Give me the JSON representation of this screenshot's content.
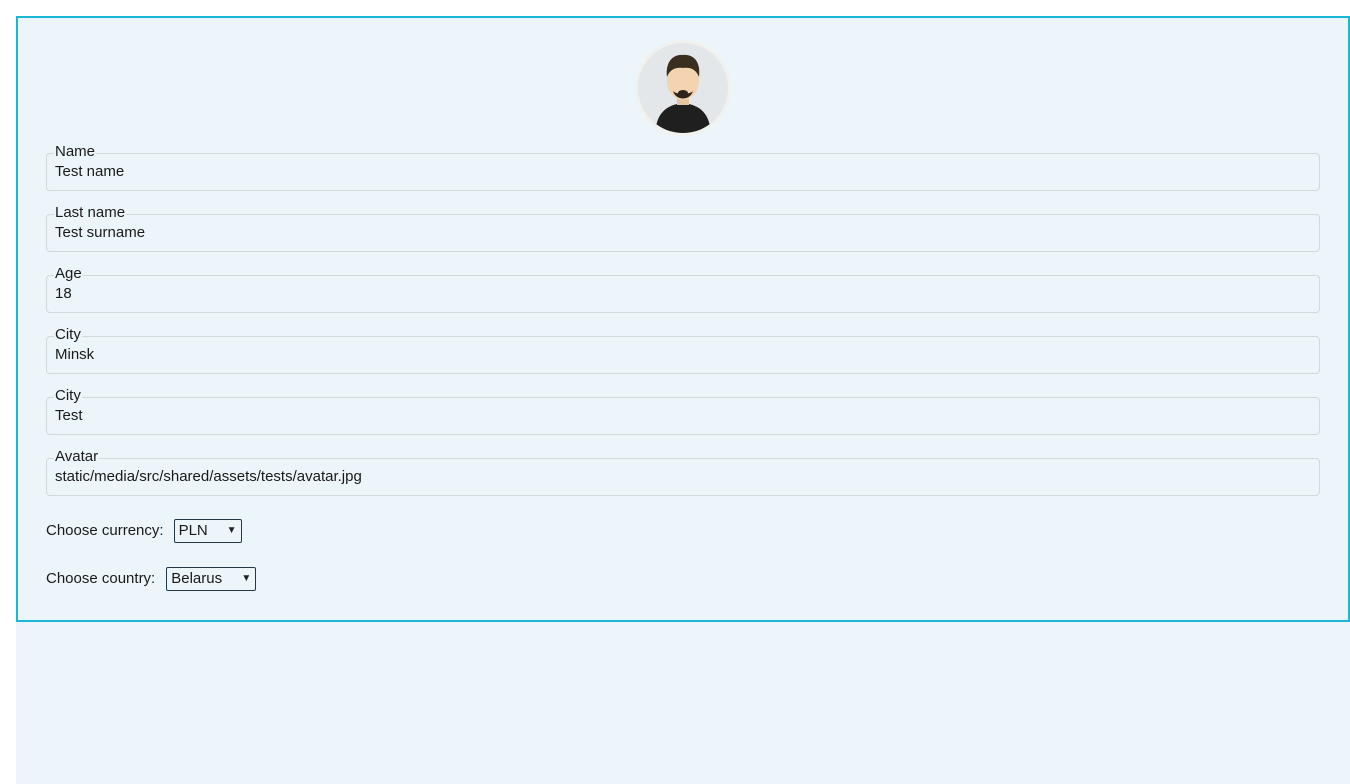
{
  "avatar_icon": "user-avatar-icon",
  "fields": [
    {
      "label": "Name",
      "value": "Test name"
    },
    {
      "label": "Last name",
      "value": "Test surname"
    },
    {
      "label": "Age",
      "value": "18"
    },
    {
      "label": "City",
      "value": "Minsk"
    },
    {
      "label": "City",
      "value": "Test"
    },
    {
      "label": "Avatar",
      "value": "static/media/src/shared/assets/tests/avatar.jpg"
    }
  ],
  "currency": {
    "label": "Choose currency:",
    "selected": "PLN"
  },
  "country": {
    "label": "Choose country:",
    "selected": "Belarus"
  },
  "colors": {
    "accent": "#1ab8d6",
    "background": "#ecf5f9"
  }
}
